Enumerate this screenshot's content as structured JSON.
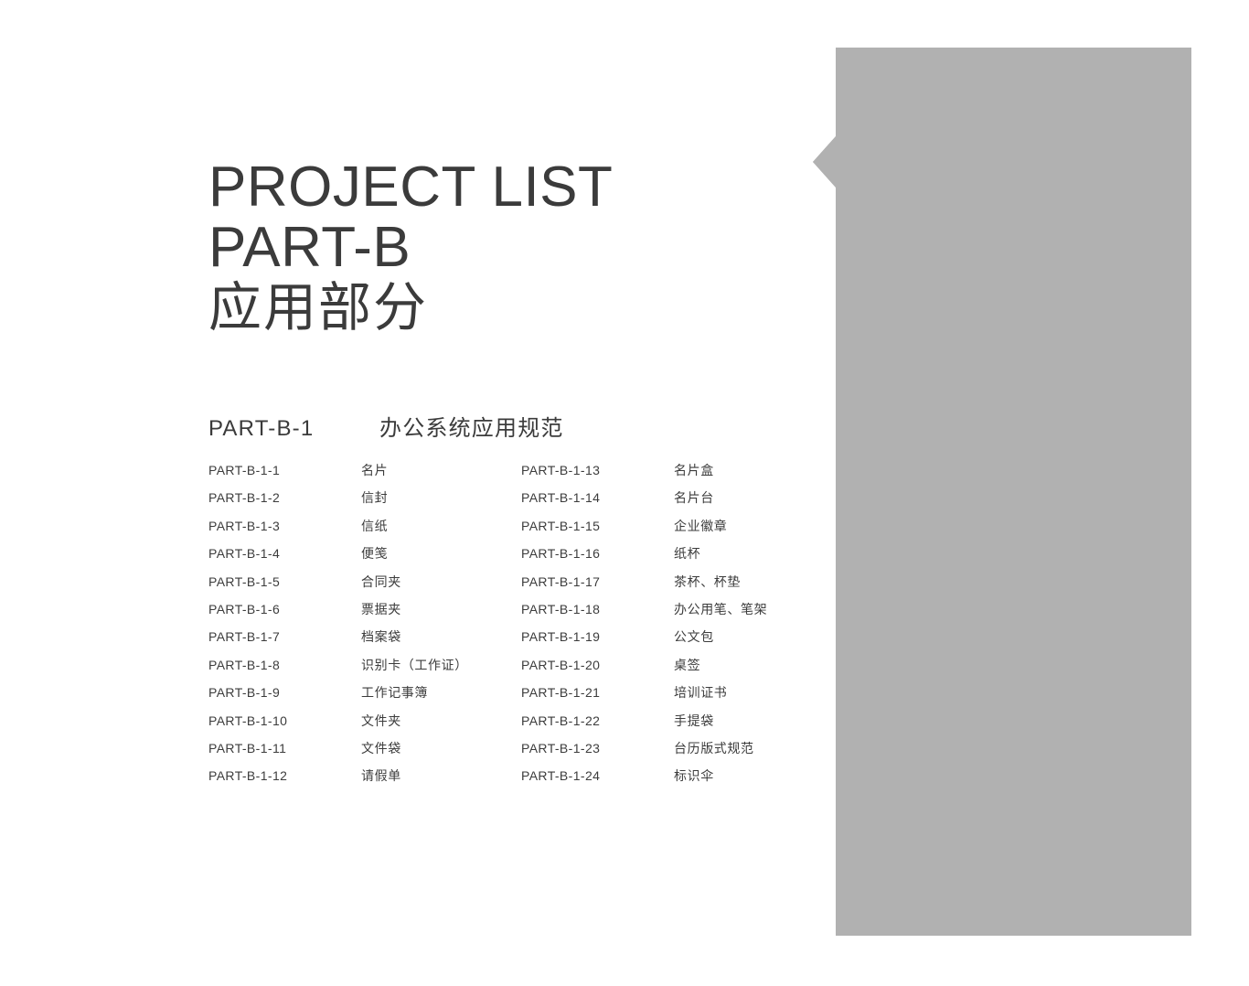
{
  "page": {
    "background_color": "#ffffff",
    "text_color": "#3b3b3b"
  },
  "decor": {
    "shape_name": "gray-banner-with-left-arrow-notch",
    "fill_color": "#b1b1b1"
  },
  "title": {
    "line1": "PROJECT LIST",
    "line2": "PART-B",
    "line3": "应用部分"
  },
  "section": {
    "code": "PART-B-1",
    "name": "办公系统应用规范"
  },
  "items": {
    "left": [
      {
        "code": "PART-B-1-1",
        "name": "名片"
      },
      {
        "code": "PART-B-1-2",
        "name": "信封"
      },
      {
        "code": "PART-B-1-3",
        "name": "信纸"
      },
      {
        "code": "PART-B-1-4",
        "name": "便笺"
      },
      {
        "code": "PART-B-1-5",
        "name": "合同夹"
      },
      {
        "code": "PART-B-1-6",
        "name": "票据夹"
      },
      {
        "code": "PART-B-1-7",
        "name": "档案袋"
      },
      {
        "code": "PART-B-1-8",
        "name": "识别卡（工作证）"
      },
      {
        "code": "PART-B-1-9",
        "name": "工作记事簿"
      },
      {
        "code": "PART-B-1-10",
        "name": "文件夹"
      },
      {
        "code": "PART-B-1-11",
        "name": "文件袋"
      },
      {
        "code": "PART-B-1-12",
        "name": "请假单"
      }
    ],
    "right": [
      {
        "code": "PART-B-1-13",
        "name": "名片盒"
      },
      {
        "code": "PART-B-1-14",
        "name": "名片台"
      },
      {
        "code": "PART-B-1-15",
        "name": "企业徽章"
      },
      {
        "code": "PART-B-1-16",
        "name": "纸杯"
      },
      {
        "code": "PART-B-1-17",
        "name": "茶杯、杯垫"
      },
      {
        "code": "PART-B-1-18",
        "name": "办公用笔、笔架"
      },
      {
        "code": "PART-B-1-19",
        "name": "公文包"
      },
      {
        "code": "PART-B-1-20",
        "name": "桌签"
      },
      {
        "code": "PART-B-1-21",
        "name": "培训证书"
      },
      {
        "code": "PART-B-1-22",
        "name": "手提袋"
      },
      {
        "code": "PART-B-1-23",
        "name": "台历版式规范"
      },
      {
        "code": "PART-B-1-24",
        "name": "标识伞"
      }
    ]
  }
}
